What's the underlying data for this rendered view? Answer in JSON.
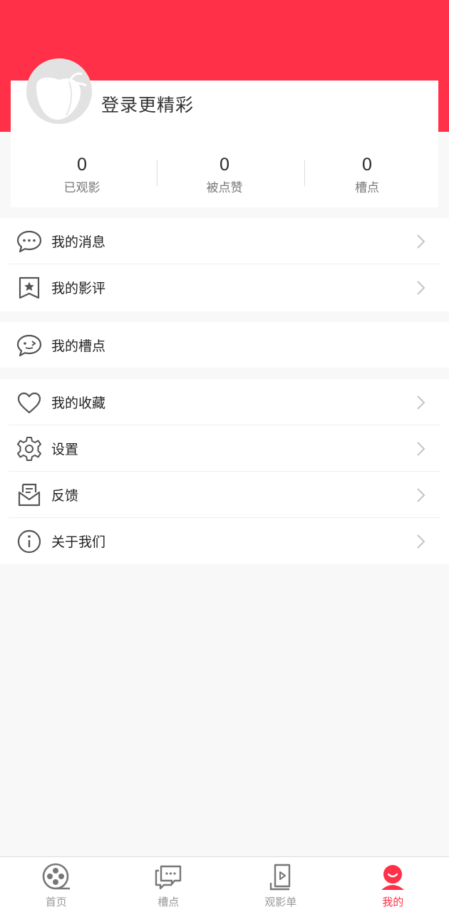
{
  "profile": {
    "login_prompt": "登录更精彩"
  },
  "stats": [
    {
      "value": "0",
      "label": "已观影"
    },
    {
      "value": "0",
      "label": "被点赞"
    },
    {
      "value": "0",
      "label": "槽点"
    }
  ],
  "menu": {
    "messages": "我的消息",
    "reviews": "我的影评",
    "slots": "我的槽点",
    "favorites": "我的收藏",
    "settings": "设置",
    "feedback": "反馈",
    "about": "关于我们"
  },
  "tabbar": [
    {
      "label": "首页",
      "icon": "film-reel-icon"
    },
    {
      "label": "槽点",
      "icon": "chat-bubbles-icon"
    },
    {
      "label": "观影单",
      "icon": "playlist-icon"
    },
    {
      "label": "我的",
      "icon": "user-icon"
    }
  ],
  "colors": {
    "accent": "#ff3048",
    "background": "#f8f8f8"
  }
}
